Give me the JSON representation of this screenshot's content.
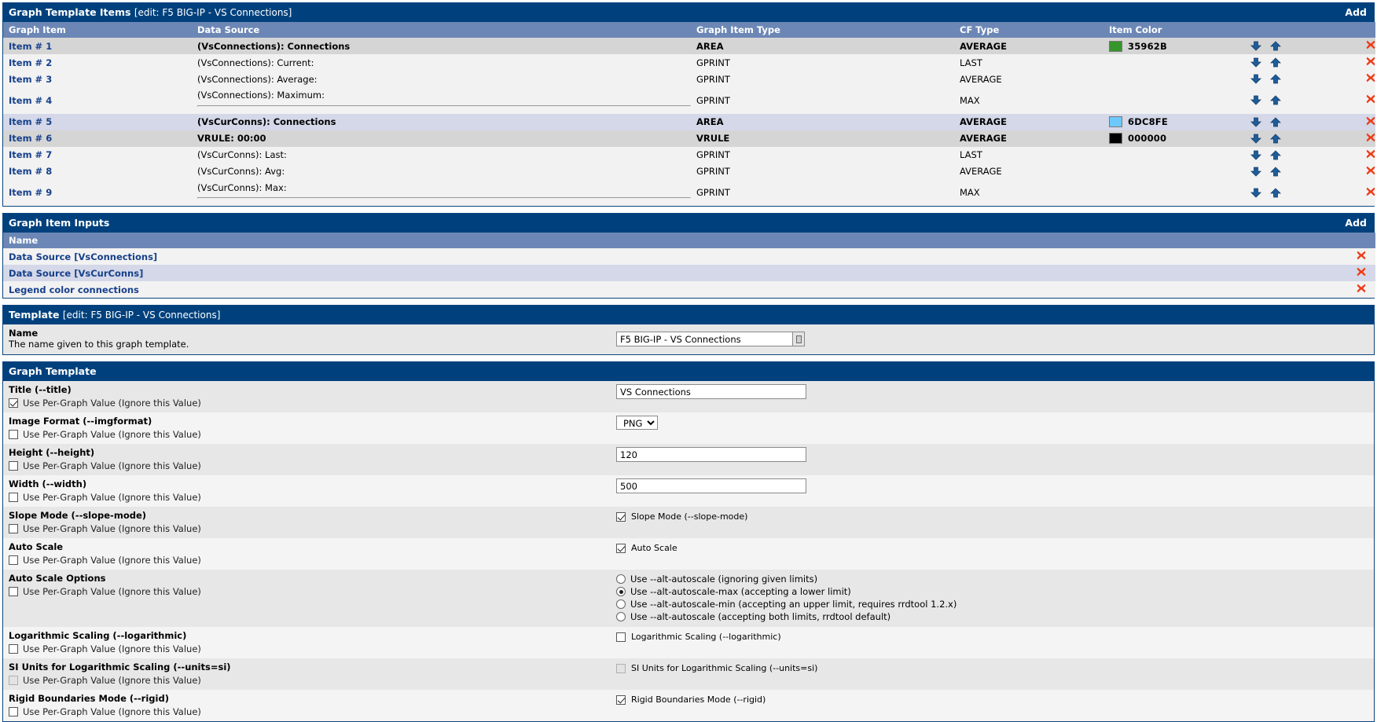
{
  "panels": {
    "items": {
      "title": "Graph Template Items",
      "subtitle": "[edit: F5 BIG-IP - VS Connections]",
      "add_label": "Add",
      "columns": [
        "Graph Item",
        "Data Source",
        "Graph Item Type",
        "CF Type",
        "Item Color"
      ],
      "rows": [
        {
          "item": "Item # 1",
          "source": "(VsConnections): Connections",
          "type": "AREA",
          "cf": "AVERAGE",
          "color_hex": "35962B",
          "color": "#35962B",
          "bold": true,
          "highlight": "hl"
        },
        {
          "item": "Item # 2",
          "source": "(VsConnections): Current:",
          "type": "GPRINT",
          "cf": "LAST",
          "color_hex": "",
          "color": "",
          "bold": false,
          "highlight": "alt0"
        },
        {
          "item": "Item # 3",
          "source": "(VsConnections): Average:",
          "type": "GPRINT",
          "cf": "AVERAGE",
          "color_hex": "",
          "color": "",
          "bold": false,
          "highlight": "alt0"
        },
        {
          "item": "Item # 4",
          "source": "(VsConnections): Maximum:",
          "source_tag": "<HR>",
          "type": "GPRINT",
          "cf": "MAX",
          "color_hex": "",
          "color": "",
          "bold": false,
          "highlight": "alt0"
        },
        {
          "item": "Item # 5",
          "source": "(VsCurConns): Connections",
          "type": "AREA",
          "cf": "AVERAGE",
          "color_hex": "6DC8FE",
          "color": "#6DC8FE",
          "bold": true,
          "highlight": "sel"
        },
        {
          "item": "Item # 6",
          "source": "VRULE: 00:00",
          "type": "VRULE",
          "cf": "AVERAGE",
          "color_hex": "000000",
          "color": "#000000",
          "bold": true,
          "highlight": "hl"
        },
        {
          "item": "Item # 7",
          "source": "(VsCurConns): Last:",
          "type": "GPRINT",
          "cf": "LAST",
          "color_hex": "",
          "color": "",
          "bold": false,
          "highlight": "alt0"
        },
        {
          "item": "Item # 8",
          "source": "(VsCurConns): Avg:",
          "type": "GPRINT",
          "cf": "AVERAGE",
          "color_hex": "",
          "color": "",
          "bold": false,
          "highlight": "alt0"
        },
        {
          "item": "Item # 9",
          "source": "(VsCurConns): Max:",
          "source_tag": "<HR>",
          "type": "GPRINT",
          "cf": "MAX",
          "color_hex": "",
          "color": "",
          "bold": false,
          "highlight": "alt0"
        }
      ]
    },
    "inputs": {
      "title": "Graph Item Inputs",
      "add_label": "Add",
      "column": "Name",
      "rows": [
        {
          "name": "Data Source [VsConnections]"
        },
        {
          "name": "Data Source [VsCurConns]"
        },
        {
          "name": "Legend color connections"
        }
      ]
    },
    "template": {
      "title": "Template",
      "subtitle": "[edit: F5 BIG-IP - VS Connections]",
      "name_label": "Name",
      "name_desc": "The name given to this graph template.",
      "name_value": "F5 BIG-IP - VS Connections"
    },
    "graph_template": {
      "title": "Graph Template",
      "per_graph_label": "Use Per-Graph Value (Ignore this Value)",
      "fields": [
        {
          "label": "Title (--title)",
          "per_graph": true,
          "control": "text",
          "value": "VS Connections"
        },
        {
          "label": "Image Format (--imgformat)",
          "per_graph": false,
          "control": "select",
          "value": "PNG"
        },
        {
          "label": "Height (--height)",
          "per_graph": false,
          "control": "text",
          "value": "120"
        },
        {
          "label": "Width (--width)",
          "per_graph": false,
          "control": "text",
          "value": "500"
        },
        {
          "label": "Slope Mode (--slope-mode)",
          "per_graph": false,
          "control": "checkbox",
          "checked": true,
          "check_label": "Slope Mode (--slope-mode)"
        },
        {
          "label": "Auto Scale",
          "per_graph": false,
          "control": "checkbox",
          "checked": true,
          "check_label": "Auto Scale"
        },
        {
          "label": "Auto Scale Options",
          "per_graph": false,
          "control": "radios",
          "options": [
            {
              "text": "Use --alt-autoscale (ignoring given limits)",
              "selected": false
            },
            {
              "text": "Use --alt-autoscale-max (accepting a lower limit)",
              "selected": true
            },
            {
              "text": "Use --alt-autoscale-min (accepting an upper limit, requires rrdtool 1.2.x)",
              "selected": false
            },
            {
              "text": "Use --alt-autoscale (accepting both limits, rrdtool default)",
              "selected": false
            }
          ]
        },
        {
          "label": "Logarithmic Scaling (--logarithmic)",
          "per_graph": false,
          "control": "checkbox",
          "checked": false,
          "check_label": "Logarithmic Scaling (--logarithmic)"
        },
        {
          "label": "SI Units for Logarithmic Scaling (--units=si)",
          "per_graph": false,
          "per_graph_disabled": true,
          "control": "checkbox",
          "checked": false,
          "disabled": true,
          "check_label": "SI Units for Logarithmic Scaling (--units=si)"
        },
        {
          "label": "Rigid Boundaries Mode (--rigid)",
          "per_graph": false,
          "control": "checkbox",
          "checked": true,
          "check_label": "Rigid Boundaries Mode (--rigid)"
        }
      ]
    }
  },
  "icons": {
    "move_down": "move-down-arrow-icon",
    "move_up": "move-up-arrow-icon",
    "delete": "delete-x-icon",
    "dropdown": "chevron-down-icon",
    "name_field_button": "name-field-picker-icon"
  },
  "colors": {
    "header_blue": "#00417d",
    "subheader_blue": "#6c87b5",
    "link_blue": "#17408b",
    "delete_red": "#ee3b16",
    "arrow_blue": "#1f5c99"
  }
}
